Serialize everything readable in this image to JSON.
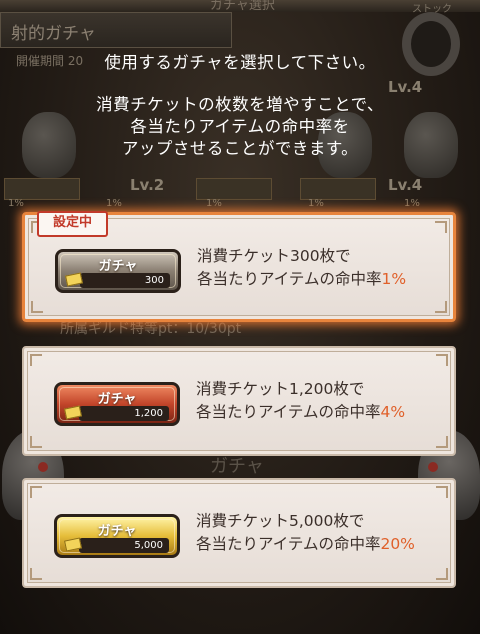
{
  "background": {
    "header_title": "ガチャ選択",
    "tab_label": "射的ガチャ",
    "period_label": "開催期間 20",
    "stock_label": "ストック",
    "levels": [
      "Lv.4",
      "Lv.2",
      "Lv.4"
    ],
    "percents": [
      "1%",
      "1%",
      "1%",
      "1%",
      "1%"
    ],
    "guild_points": "所属ギルド特等pt：10/30pt",
    "gacha_word": "ガチャ"
  },
  "instruction": {
    "line1": "使用するガチャを選択して下さい。",
    "line2": "消費チケットの枚数を増やすことで、",
    "line3": "各当たりアイテムの命中率を",
    "line4": "アップさせることができます。"
  },
  "options": [
    {
      "selected_badge": "設定中",
      "button_label": "ガチャ",
      "cost": "300",
      "desc_line1": "消費チケット300枚で",
      "desc_line2_prefix": "各当たりアイテムの命中率",
      "rate": "1%"
    },
    {
      "button_label": "ガチャ",
      "cost": "1,200",
      "desc_line1": "消費チケット1,200枚で",
      "desc_line2_prefix": "各当たりアイテムの命中率",
      "rate": "4%"
    },
    {
      "button_label": "ガチャ",
      "cost": "5,000",
      "desc_line1": "消費チケット5,000枚で",
      "desc_line2_prefix": "各当たりアイテムの命中率",
      "rate": "20%"
    }
  ],
  "colors": {
    "rate_accent": "#e0602a",
    "selected_glow": "#e8843c",
    "badge_red": "#c23a2a"
  },
  "icons": [
    "ticket-icon",
    "ring-icon"
  ]
}
